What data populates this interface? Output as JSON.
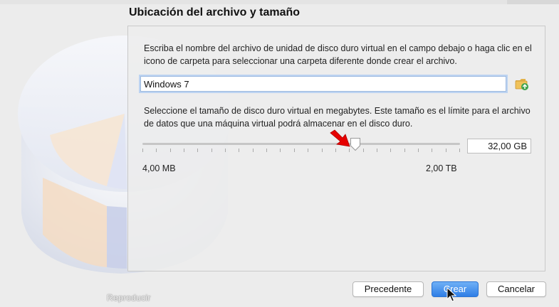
{
  "dialog": {
    "section_title": "Ubicación del archivo y tamaño",
    "location_description": "Escriba el nombre del archivo de unidad de disco duro virtual en el campo debajo o haga clic en el icono de carpeta para seleccionar una carpeta diferente donde crear el archivo.",
    "file_name_value": "Windows 7",
    "size_description": "Seleccione el tamaño de disco duro virtual en megabytes. Este tamaño es el límite para el archivo de datos que una máquina virtual podrá almacenar en el disco duro.",
    "size_value": "32,00 GB",
    "size_fraction": 0.67,
    "range_min": "4,00 MB",
    "range_max": "2,00 TB"
  },
  "buttons": {
    "previous": "Precedente",
    "create": "Crear",
    "cancel": "Cancelar"
  },
  "overlay": {
    "watermark": "Reproducir"
  },
  "icons": {
    "folder": "folder-icon",
    "annotation_arrow": "red-arrow-icon",
    "cursor": "mouse-pointer-icon"
  },
  "colors": {
    "accent": "#2f7ee6",
    "annotation": "#e60000"
  }
}
